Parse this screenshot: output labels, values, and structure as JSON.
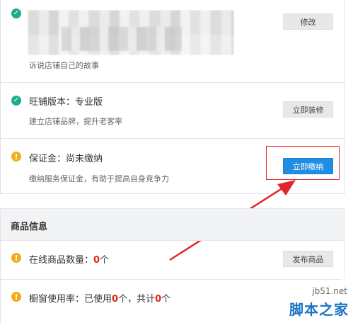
{
  "store_story": {
    "description": "诉说店铺自己的故事",
    "button_label": "修改"
  },
  "wangpu_version": {
    "title": "旺铺版本：专业版",
    "description": "建立店铺品牌，提升老客率",
    "button_label": "立即装修"
  },
  "deposit": {
    "title": "保证金：尚未缴纳",
    "description": "缴纳服务保证金，有助于提高自身竞争力",
    "button_label": "立即缴纳"
  },
  "product_info": {
    "header": "商品信息",
    "online_count": {
      "label": "在线商品数量：",
      "value": "0",
      "unit": "个",
      "button_label": "发布商品"
    },
    "window_usage": {
      "label": "橱窗使用率：已使用",
      "used": "0",
      "middle": "个，共计",
      "total": "0",
      "unit": "个"
    }
  },
  "watermark": {
    "url": "jb51.net",
    "site_name": "脚本之家"
  },
  "colors": {
    "ok_icon": "#1aac8b",
    "warn_icon": "#f0ad1a",
    "primary_button": "#1f8ee3",
    "highlight_red": "#e1262c"
  },
  "icons": {
    "ok": "check-circle-icon",
    "warn": "exclamation-circle-icon"
  }
}
